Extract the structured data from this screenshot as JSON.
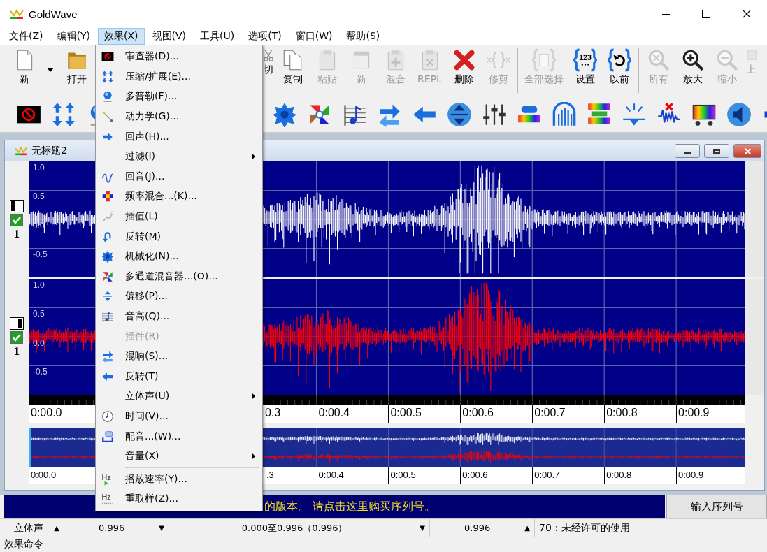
{
  "window": {
    "title": "GoldWave"
  },
  "menu_bar": [
    {
      "label": "文件(Z)",
      "selected": false
    },
    {
      "label": "编辑(Y)",
      "selected": false
    },
    {
      "label": "效果(X)",
      "selected": true
    },
    {
      "label": "视图(V)",
      "selected": false
    },
    {
      "label": "工具(U)",
      "selected": false
    },
    {
      "label": "选项(T)",
      "selected": false
    },
    {
      "label": "窗口(W)",
      "selected": false
    },
    {
      "label": "帮助(S)",
      "selected": false
    }
  ],
  "toolbar": [
    [
      {
        "label": "新",
        "disabled": false
      },
      {
        "label": "打开",
        "disabled": false
      },
      {
        "label": "切",
        "disabled": false
      },
      {
        "label": "复制",
        "disabled": false
      },
      {
        "label": "粘贴",
        "disabled": true
      },
      {
        "label": "新",
        "disabled": true
      },
      {
        "label": "混合",
        "disabled": true
      },
      {
        "label": "REPL",
        "disabled": true
      },
      {
        "label": "删除",
        "disabled": false
      },
      {
        "label": "修剪",
        "disabled": true
      }
    ],
    [
      {
        "label": "全部选择",
        "disabled": true
      },
      {
        "label": "设置",
        "disabled": false,
        "icon_text": "123"
      },
      {
        "label": "以前",
        "disabled": false
      }
    ],
    [
      {
        "label": "所有",
        "disabled": true
      },
      {
        "label": "放大",
        "disabled": false
      },
      {
        "label": "缩小",
        "disabled": true
      },
      {
        "label": "上",
        "disabled": true
      }
    ]
  ],
  "effects_menu": [
    {
      "label": "审查器(D)...",
      "disabled": false,
      "submenu": false
    },
    {
      "label": "压缩/扩展(E)...",
      "disabled": false,
      "submenu": false
    },
    {
      "label": "多普勒(F)...",
      "disabled": false,
      "submenu": false
    },
    {
      "label": "动力学(G)...",
      "disabled": false,
      "submenu": false
    },
    {
      "label": "回声(H)...",
      "disabled": false,
      "submenu": false
    },
    {
      "label": "过滤(I)",
      "disabled": false,
      "submenu": true
    },
    {
      "label": "回音(J)...",
      "disabled": false,
      "submenu": false
    },
    {
      "label": "频率混合...(K)...",
      "disabled": false,
      "submenu": false
    },
    {
      "label": "插值(L)",
      "disabled": false,
      "submenu": false
    },
    {
      "label": "反转(M)",
      "disabled": false,
      "submenu": false
    },
    {
      "label": "机械化(N)...",
      "disabled": false,
      "submenu": false
    },
    {
      "label": "多通道混音器...(O)...",
      "disabled": false,
      "submenu": false
    },
    {
      "label": "偏移(P)...",
      "disabled": false,
      "submenu": false
    },
    {
      "label": "音高(Q)...",
      "disabled": false,
      "submenu": false
    },
    {
      "label": "插件(R)",
      "disabled": true,
      "submenu": false
    },
    {
      "label": "混响(S)...",
      "disabled": false,
      "submenu": false
    },
    {
      "label": "反转(T)",
      "disabled": false,
      "submenu": false
    },
    {
      "label": "立体声(U)",
      "disabled": false,
      "submenu": true
    },
    {
      "label": "时间(V)...",
      "disabled": false,
      "submenu": false
    },
    {
      "label": "配音...(W)...",
      "disabled": false,
      "submenu": false
    },
    {
      "label": "音量(X)",
      "disabled": false,
      "submenu": true
    },
    {
      "label": "播放速率(Y)...",
      "disabled": false,
      "submenu": false,
      "separator_before": true,
      "icon_text": "Hz"
    },
    {
      "label": "重取样(Z)...",
      "disabled": false,
      "submenu": false,
      "icon_text": "Hz"
    }
  ],
  "document": {
    "title": "无标题2",
    "channels": [
      {
        "label": "1",
        "enabled": true,
        "color": "#ffffff",
        "y_ticks": [
          "1.0",
          "0.5",
          "0.0",
          "-0.5"
        ]
      },
      {
        "label": "1",
        "enabled": true,
        "color": "#ff0000",
        "y_ticks": [
          "1.0",
          "0.5",
          "0.0",
          "-0.5"
        ]
      }
    ],
    "time_ruler": [
      "0:00.0",
      "0.3",
      "0:00.4",
      "0:00.5",
      "0:00.6",
      "0:00.7",
      "0:00.8",
      "0:00.9"
    ],
    "overview_ruler": [
      "0:00.0",
      ".3",
      "0:00.4",
      "0:00.5",
      "0:00.6",
      "0:00.7",
      "0:00.8",
      "0:00.9"
    ]
  },
  "banner": {
    "text": "的版本。 请点击这里购买序列号。",
    "button": "输入序列号"
  },
  "status_bar": [
    {
      "text": "立体声",
      "arrow": "▲"
    },
    {
      "text": "0.996",
      "arrow": "▼"
    },
    {
      "text": "0.000至0.996（0.996）",
      "arrow": "▼"
    },
    {
      "text": "0.996",
      "arrow": "▲"
    },
    {
      "text": "70：未经许可的使用"
    }
  ],
  "hint_bar": "效果命令"
}
